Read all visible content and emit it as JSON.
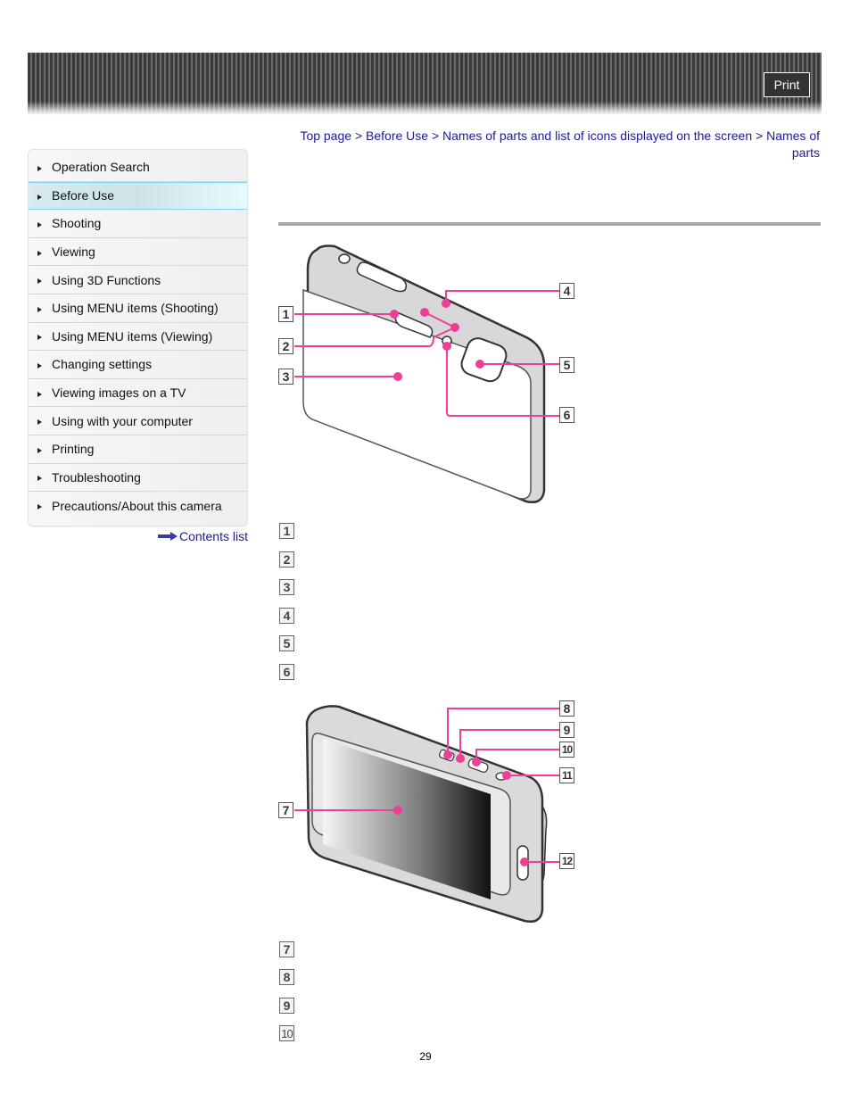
{
  "header": {
    "print_label": "Print"
  },
  "sidebar": {
    "items": [
      {
        "label": "Operation Search",
        "active": false
      },
      {
        "label": "Before Use",
        "active": true
      },
      {
        "label": "Shooting",
        "active": false
      },
      {
        "label": "Viewing",
        "active": false
      },
      {
        "label": "Using 3D Functions",
        "active": false
      },
      {
        "label": "Using MENU items (Shooting)",
        "active": false
      },
      {
        "label": "Using MENU items (Viewing)",
        "active": false
      },
      {
        "label": "Changing settings",
        "active": false
      },
      {
        "label": "Viewing images on a TV",
        "active": false
      },
      {
        "label": "Using with your computer",
        "active": false
      },
      {
        "label": "Printing",
        "active": false
      },
      {
        "label": "Troubleshooting",
        "active": false
      },
      {
        "label": "Precautions/About this camera",
        "active": false
      }
    ],
    "contents_link": "Contents list"
  },
  "breadcrumb": {
    "items": [
      "Top page",
      "Before Use",
      "Names of parts and list of icons displayed on the screen",
      "Names of parts"
    ],
    "separator": ">"
  },
  "figure1": {
    "callouts": [
      "1",
      "2",
      "3",
      "4",
      "5",
      "6"
    ]
  },
  "legend1": [
    "1",
    "2",
    "3",
    "4",
    "5",
    "6"
  ],
  "figure2": {
    "callouts": [
      "7",
      "8",
      "9",
      "10",
      "11",
      "12"
    ]
  },
  "legend2": [
    "7",
    "8",
    "9",
    "10"
  ],
  "colors": {
    "callout_line": "#ee3f97",
    "link": "#1a1a9a"
  },
  "page_number": "29"
}
